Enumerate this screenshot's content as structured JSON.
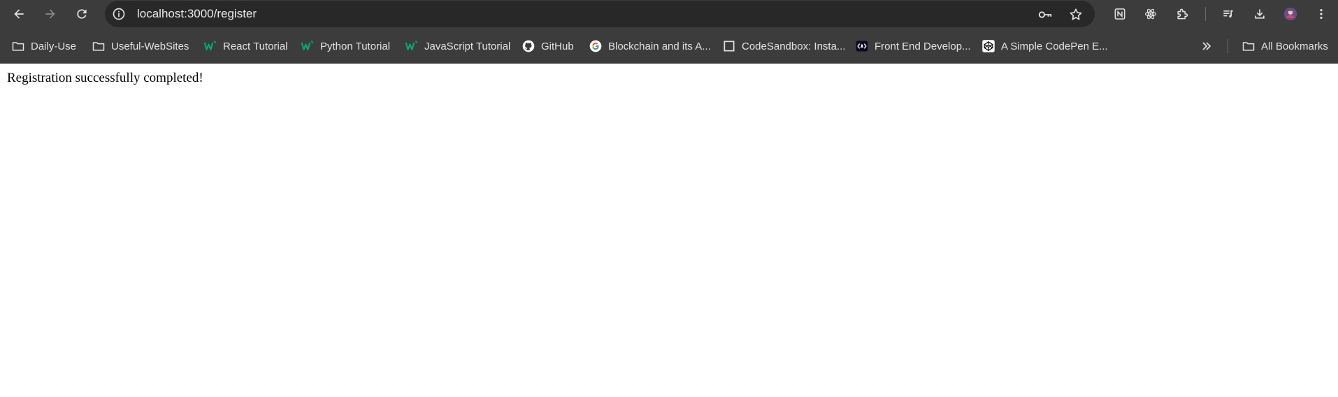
{
  "browser": {
    "url": "localhost:3000/register",
    "accent_color": "#3c3c3c",
    "icons": [
      "back-icon",
      "forward-icon",
      "reload-icon",
      "site-info-icon",
      "key-icon",
      "star-icon",
      "notion-icon",
      "react-devtools-icon",
      "extensions-icon",
      "reading-list-icon",
      "download-icon",
      "profile-avatar",
      "kebab-menu-icon"
    ]
  },
  "bookmarks": {
    "items": [
      {
        "label": "Daily-Use",
        "icon": "folder-icon"
      },
      {
        "label": "Useful-WebSites",
        "icon": "folder-icon"
      },
      {
        "label": "React Tutorial",
        "icon": "w3schools-icon"
      },
      {
        "label": "Python Tutorial",
        "icon": "w3schools-icon"
      },
      {
        "label": "JavaScript Tutorial",
        "icon": "w3schools-icon"
      },
      {
        "label": "GitHub",
        "icon": "github-icon"
      },
      {
        "label": "Blockchain and its A...",
        "icon": "google-icon"
      },
      {
        "label": "CodeSandbox: Insta...",
        "icon": "codesandbox-icon"
      },
      {
        "label": "Front End Develop...",
        "icon": "frontend-icon"
      },
      {
        "label": "A Simple CodePen E...",
        "icon": "codepen-icon"
      }
    ],
    "all_bookmarks_label": "All Bookmarks"
  },
  "page": {
    "message": "Registration successfully completed!"
  }
}
